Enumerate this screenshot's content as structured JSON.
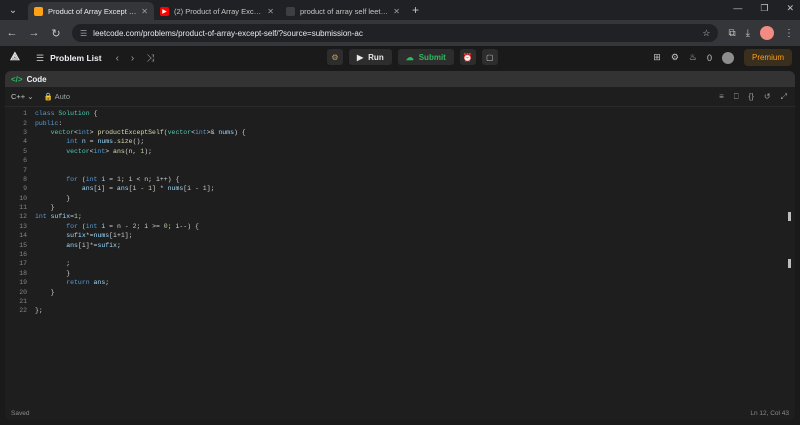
{
  "browser": {
    "tabs": [
      {
        "title": "Product of Array Except Self - L",
        "active": true,
        "favicon": "leetcode-icon"
      },
      {
        "title": "(2) Product of Array Except Self",
        "active": false,
        "favicon": "youtube-icon"
      },
      {
        "title": "product of array self leetcode p",
        "active": false,
        "favicon": "search-icon"
      }
    ],
    "url": "leetcode.com/problems/product-of-array-except-self/?source=submission-ac"
  },
  "header": {
    "problem_list": "Problem List",
    "run": "Run",
    "submit": "Submit",
    "fire_count": "0",
    "premium": "Premium"
  },
  "panel": {
    "title": "Code",
    "language": "C++",
    "autosave": "Auto"
  },
  "code_lines": [
    [
      [
        "kw",
        "class "
      ],
      [
        "tp",
        "Solution "
      ],
      [
        "",
        "{"
      ]
    ],
    [
      [
        "kw",
        "public"
      ],
      [
        "",
        ":"
      ]
    ],
    [
      [
        "",
        "    "
      ],
      [
        "tp",
        "vector"
      ],
      [
        "",
        "<"
      ],
      [
        "kw",
        "int"
      ],
      [
        "",
        "> "
      ],
      [
        "fn",
        "productExceptSelf"
      ],
      [
        "",
        "("
      ],
      [
        "tp",
        "vector"
      ],
      [
        "",
        "<"
      ],
      [
        "kw",
        "int"
      ],
      [
        "",
        ">& "
      ],
      [
        "vr",
        "nums"
      ],
      [
        "",
        ") {"
      ]
    ],
    [
      [
        "",
        "        "
      ],
      [
        "kw",
        "int "
      ],
      [
        "vr",
        "n "
      ],
      [
        "",
        "= "
      ],
      [
        "vr",
        "nums"
      ],
      [
        "",
        "."
      ],
      [
        "fn",
        "size"
      ],
      [
        "",
        "();"
      ]
    ],
    [
      [
        "",
        "        "
      ],
      [
        "tp",
        "vector"
      ],
      [
        "",
        "<"
      ],
      [
        "kw",
        "int"
      ],
      [
        "",
        "> "
      ],
      [
        "fn",
        "ans"
      ],
      [
        "",
        "(n, "
      ],
      [
        "nm",
        "1"
      ],
      [
        "",
        ");"
      ]
    ],
    [
      [
        "",
        ""
      ]
    ],
    [
      [
        "",
        ""
      ]
    ],
    [
      [
        "",
        "        "
      ],
      [
        "kw",
        "for "
      ],
      [
        "",
        "("
      ],
      [
        "kw",
        "int "
      ],
      [
        "vr",
        "i "
      ],
      [
        "",
        "= "
      ],
      [
        "nm",
        "1"
      ],
      [
        "",
        "; i < n; i++) {"
      ]
    ],
    [
      [
        "",
        "            "
      ],
      [
        "vr",
        "ans"
      ],
      [
        "",
        "[i] = "
      ],
      [
        "vr",
        "ans"
      ],
      [
        "",
        "[i - "
      ],
      [
        "nm",
        "1"
      ],
      [
        "",
        "] * "
      ],
      [
        "vr",
        "nums"
      ],
      [
        "",
        "[i - "
      ],
      [
        "nm",
        "1"
      ],
      [
        "",
        "];"
      ]
    ],
    [
      [
        "",
        "        }"
      ]
    ],
    [
      [
        "",
        "    }"
      ]
    ],
    [
      [
        "kw",
        "int "
      ],
      [
        "vr",
        "sufix"
      ],
      [
        "",
        "="
      ],
      [
        "nm",
        "1"
      ],
      [
        "",
        ";"
      ]
    ],
    [
      [
        "",
        "        "
      ],
      [
        "kw",
        "for "
      ],
      [
        "",
        "("
      ],
      [
        "kw",
        "int "
      ],
      [
        "vr",
        "i "
      ],
      [
        "",
        "= n - "
      ],
      [
        "nm",
        "2"
      ],
      [
        "",
        "; i >= "
      ],
      [
        "nm",
        "0"
      ],
      [
        "",
        "; i--) {"
      ]
    ],
    [
      [
        "",
        "        "
      ],
      [
        "vr",
        "sufix"
      ],
      [
        "",
        "*="
      ],
      [
        "vr",
        "nums"
      ],
      [
        "",
        "[i+"
      ],
      [
        "nm",
        "1"
      ],
      [
        "",
        "];"
      ]
    ],
    [
      [
        "",
        "        "
      ],
      [
        "vr",
        "ans"
      ],
      [
        "",
        "[i]*="
      ],
      [
        "vr",
        "sufix"
      ],
      [
        "",
        ";"
      ]
    ],
    [
      [
        "",
        ""
      ]
    ],
    [
      [
        "",
        "        ;"
      ]
    ],
    [
      [
        "",
        "        }"
      ]
    ],
    [
      [
        "",
        "        "
      ],
      [
        "kw",
        "return "
      ],
      [
        "vr",
        "ans"
      ],
      [
        "",
        ";"
      ]
    ],
    [
      [
        "",
        "    }"
      ]
    ],
    [
      [
        "",
        ""
      ]
    ],
    [
      [
        "",
        "};"
      ]
    ]
  ],
  "status": {
    "saved": "Saved",
    "cursor": "Ln 12, Col 43"
  },
  "colors": {
    "accent_green": "#2cbb5d",
    "premium_orange": "#ffa116"
  }
}
